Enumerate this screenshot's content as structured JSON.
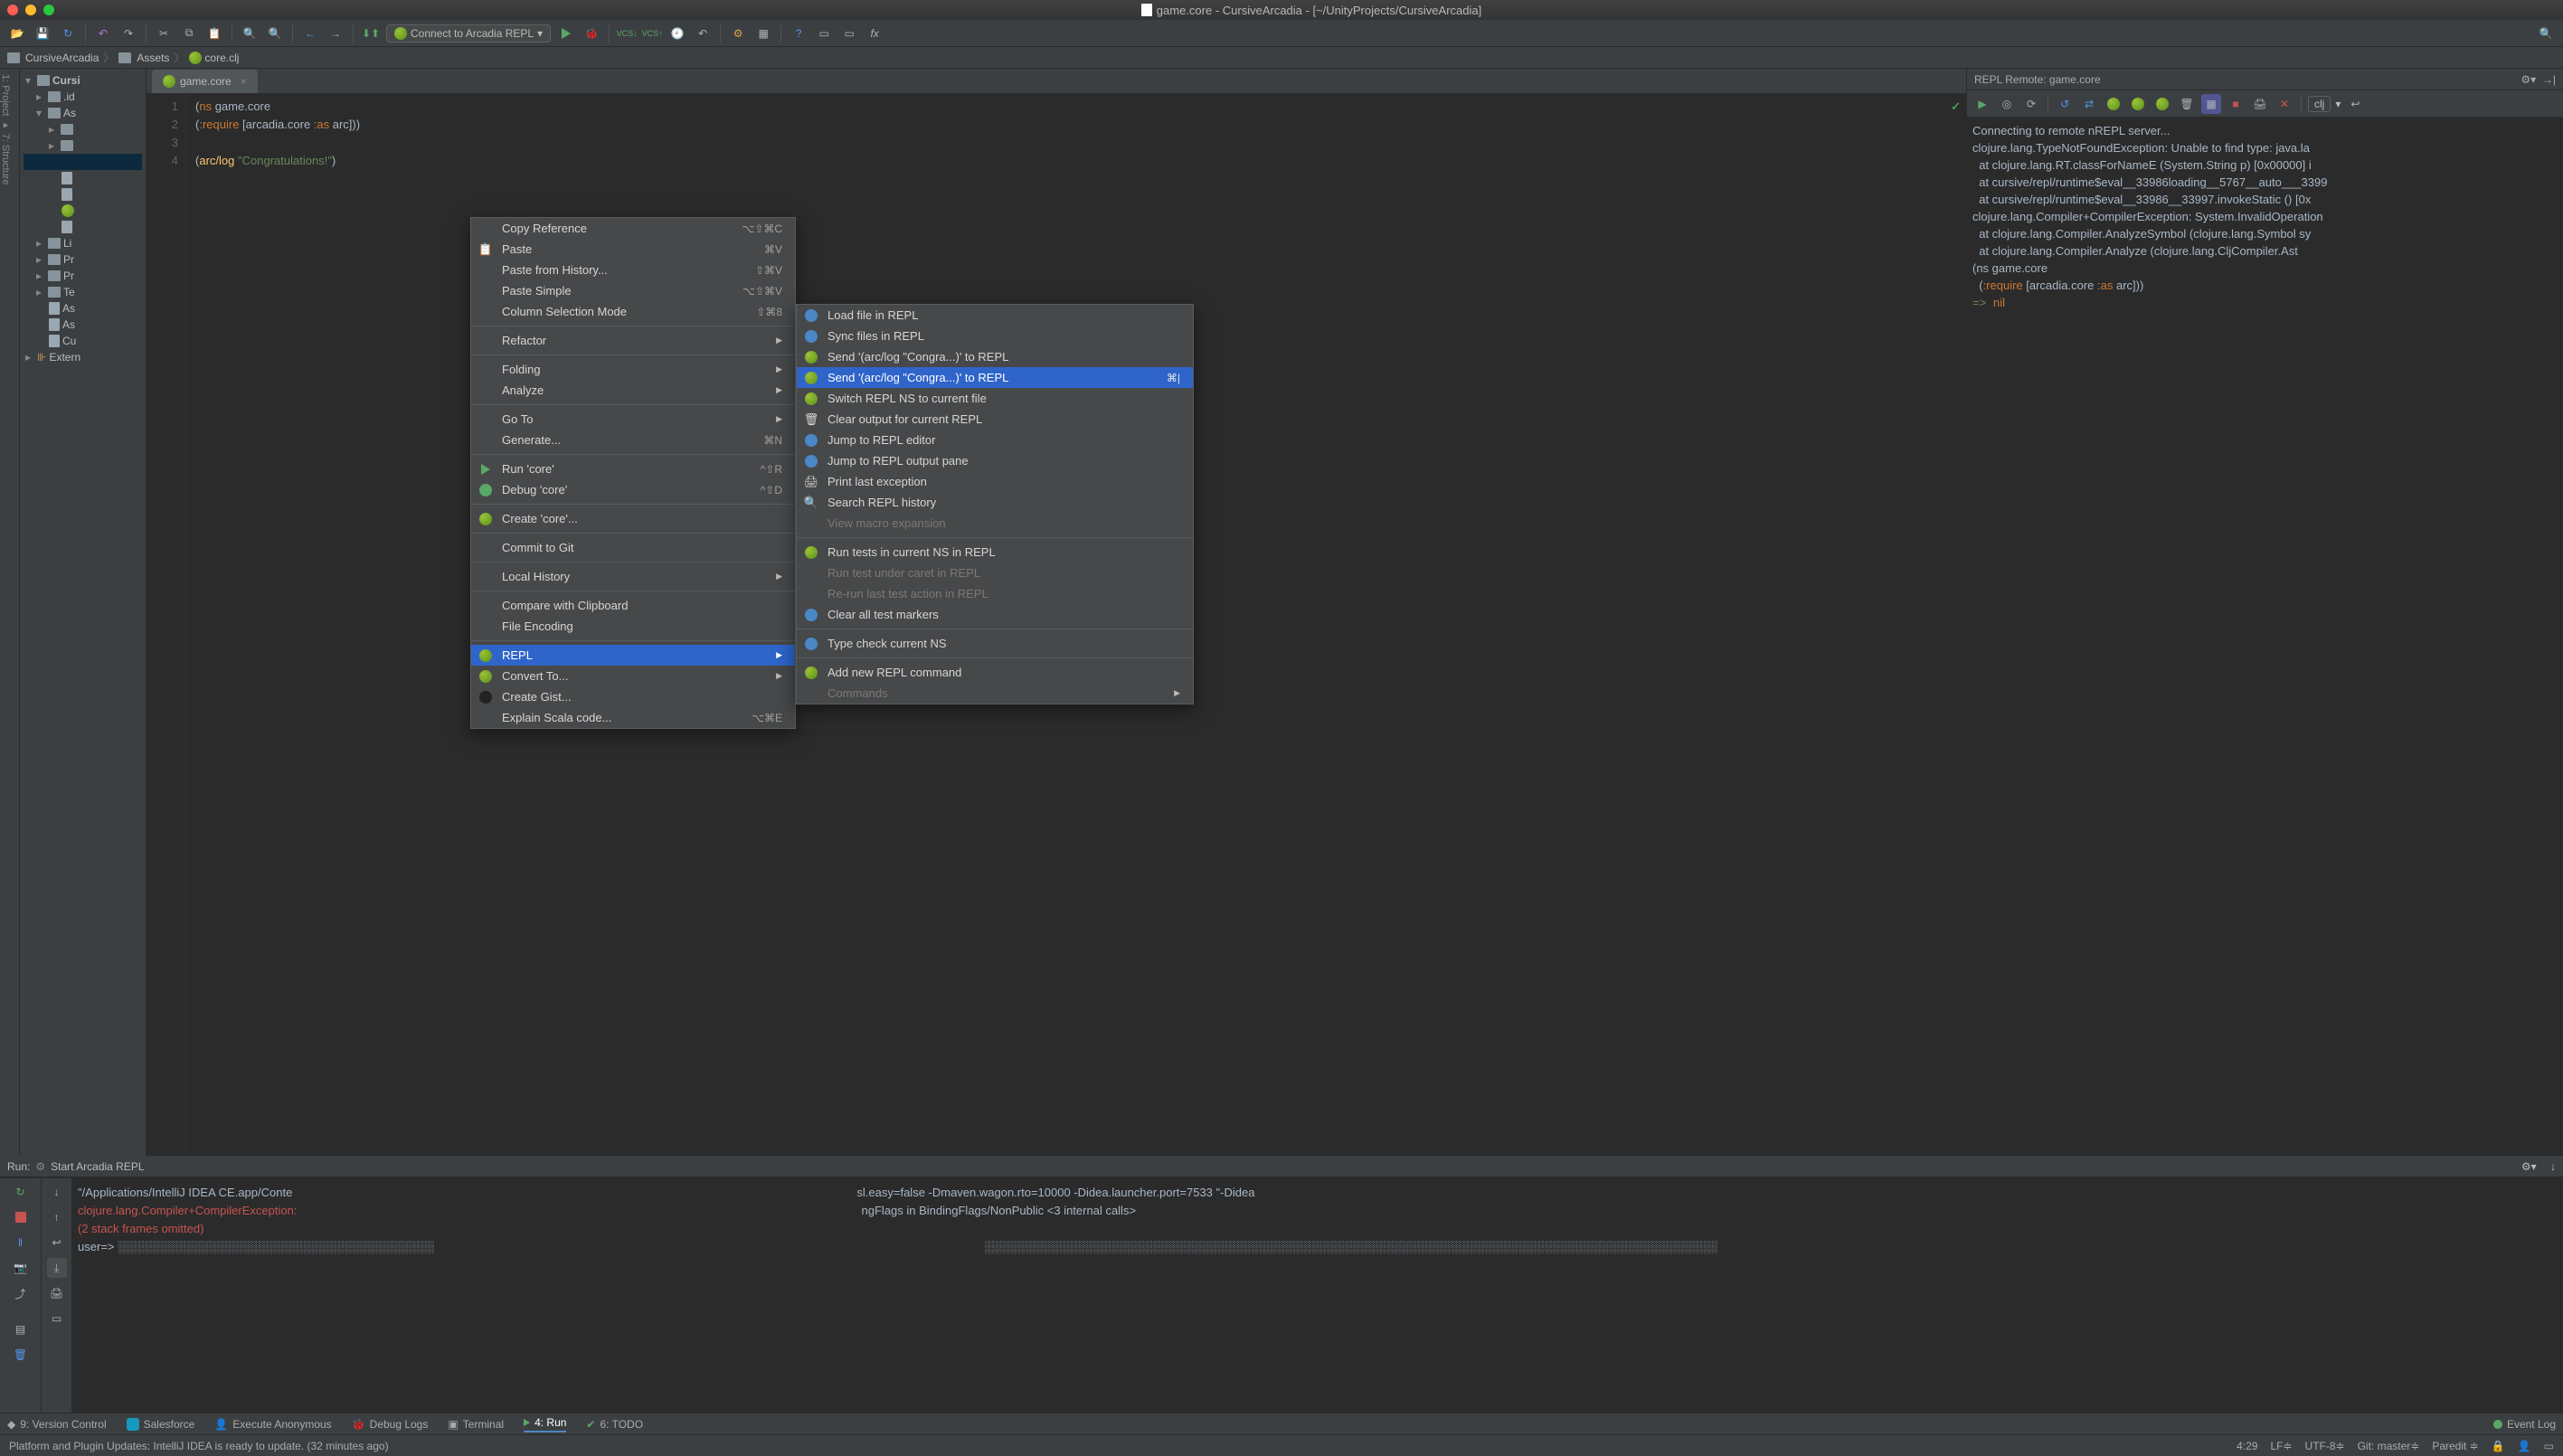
{
  "title": "game.core - CursiveArcadia - [~/UnityProjects/CursiveArcadia]",
  "run_config": "Connect to Arcadia REPL",
  "breadcrumb": {
    "a": "CursiveArcadia",
    "b": "Assets",
    "c": "core.clj"
  },
  "tree": {
    "root": "Cursi",
    "items": [
      ".id",
      "As",
      "",
      "",
      "",
      "",
      "",
      "Li",
      "Pr",
      "Pr",
      "Te",
      "As",
      "As",
      "Cu",
      "Extern"
    ]
  },
  "tab_name": "game.core",
  "code": {
    "l1a": "(",
    "l1b": "ns",
    "l1c": " game.core",
    "l2a": "  (",
    "l2b": ":require",
    "l2c": " [arcadia.core ",
    "l2d": ":as",
    "l2e": " arc]))",
    "l4a": "(",
    "l4b": "arc/log",
    "l4c": " ",
    "l4d": "\"Congratulations!\"",
    "l4e": ")"
  },
  "menu1": [
    {
      "label": "Copy Reference",
      "sc": "⌥⇧⌘C"
    },
    {
      "label": "Paste",
      "sc": "⌘V",
      "ico": "paste"
    },
    {
      "label": "Paste from History...",
      "sc": "⇧⌘V"
    },
    {
      "label": "Paste Simple",
      "sc": "⌥⇧⌘V"
    },
    {
      "label": "Column Selection Mode",
      "sc": "⇧⌘8"
    },
    {
      "sep": true
    },
    {
      "label": "Refactor",
      "arrow": true
    },
    {
      "sep": true
    },
    {
      "label": "Folding",
      "arrow": true
    },
    {
      "label": "Analyze",
      "arrow": true
    },
    {
      "sep": true
    },
    {
      "label": "Go To",
      "arrow": true
    },
    {
      "label": "Generate...",
      "sc": "⌘N"
    },
    {
      "sep": true
    },
    {
      "label": "Run 'core'",
      "sc": "^⇧R",
      "ico": "play"
    },
    {
      "label": "Debug 'core'",
      "sc": "^⇧D",
      "ico": "bug"
    },
    {
      "sep": true
    },
    {
      "label": "Create 'core'...",
      "ico": "repl"
    },
    {
      "sep": true
    },
    {
      "label": "Commit to Git"
    },
    {
      "sep": true
    },
    {
      "label": "Local History",
      "arrow": true
    },
    {
      "sep": true
    },
    {
      "label": "Compare with Clipboard"
    },
    {
      "label": "File Encoding"
    },
    {
      "sep": true
    },
    {
      "label": "REPL",
      "arrow": true,
      "hl": true,
      "ico": "repl"
    },
    {
      "label": "Convert To...",
      "arrow": true,
      "ico": "repl"
    },
    {
      "label": "Create Gist...",
      "ico": "gh"
    },
    {
      "label": "Explain Scala code...",
      "sc": "⌥⌘E"
    }
  ],
  "menu2": [
    {
      "label": "Load file in REPL",
      "ico": "repl-blue"
    },
    {
      "label": "Sync files in REPL",
      "ico": "repl-blue"
    },
    {
      "label": "Send '(arc/log \"Congra...)' to REPL",
      "ico": "repl"
    },
    {
      "label": "Send '(arc/log \"Congra...)' to REPL",
      "ico": "repl",
      "hl": true,
      "sc": "⌘|"
    },
    {
      "label": "Switch REPL NS to current file",
      "ico": "repl"
    },
    {
      "label": "Clear output for current REPL",
      "ico": "trash"
    },
    {
      "label": "Jump to REPL editor",
      "ico": "repl-blue"
    },
    {
      "label": "Jump to REPL output pane",
      "ico": "repl-blue"
    },
    {
      "label": "Print last exception",
      "ico": "print"
    },
    {
      "label": "Search REPL history",
      "ico": "search"
    },
    {
      "label": "View macro expansion",
      "disabled": true
    },
    {
      "sep": true
    },
    {
      "label": "Run tests in current NS in REPL",
      "ico": "repl"
    },
    {
      "label": "Run test under caret in REPL",
      "disabled": true
    },
    {
      "label": "Re-run last test action in REPL",
      "disabled": true
    },
    {
      "label": "Clear all test markers",
      "ico": "repl-blue"
    },
    {
      "sep": true
    },
    {
      "label": "Type check current NS",
      "ico": "type"
    },
    {
      "sep": true
    },
    {
      "label": "Add new REPL command",
      "ico": "repl"
    },
    {
      "label": "Commands",
      "arrow": true,
      "disabled": true
    }
  ],
  "repl": {
    "head": "REPL Remote: game.core",
    "clj": "clj",
    "body": "Connecting to remote nREPL server...\nclojure.lang.TypeNotFoundException: Unable to find type: java.la\n  at clojure.lang.RT.classForNameE (System.String p) [0x00000] i\n  at cursive/repl/runtime$eval__33986loading__5767__auto___3399\n  at cursive/repl/runtime$eval__33986__33997.invokeStatic () [0x\nclojure.lang.Compiler+CompilerException: System.InvalidOperation\n  at clojure.lang.Compiler.AnalyzeSymbol (clojure.lang.Symbol sy\n  at clojure.lang.Compiler.Analyze (clojure.lang.CljCompiler.Ast",
    "ns_line_a": "(ns ",
    "ns_line_b": "game.core",
    "req_line_a": "  (",
    "req_line_b": ":require",
    "req_line_c": " [arcadia.core ",
    "req_line_d": ":as",
    "req_line_e": " arc]))",
    "arrow": "=>",
    "nil": "nil"
  },
  "run": {
    "label": "Run:",
    "name": "Start Arcadia REPL",
    "line1": "\"/Applications/IntelliJ IDEA CE.app/Conte",
    "line1b": "sl.easy=false -Dmaven.wagon.rto=10000 -Didea.launcher.port=7533 \"-Didea",
    "line2": "clojure.lang.Compiler+CompilerException:",
    "line2b": "ngFlags in BindingFlags/NonPublic <3 internal calls>",
    "line3": "(2 stack frames omitted)",
    "line4": "user=> ░░░░░░░░░░░░░░░░░░░░░░░░░░░░░░░░░░░░░░",
    "line4b": "░░░░░░░░░░░░░░░░░░░░░░░░░░░░░░░░░░░░░░░░░░░░░░░░░░░░░░░░░░░░░░░░░░░░░░░░░░░░░░░░░░░░░░░░"
  },
  "bottom_tabs": {
    "vc": "9: Version Control",
    "sf": "Salesforce",
    "ea": "Execute Anonymous",
    "dl": "Debug Logs",
    "term": "Terminal",
    "run": "4: Run",
    "todo": "6: TODO",
    "el": "Event Log"
  },
  "status": {
    "msg": "Platform and Plugin Updates: IntelliJ IDEA is ready to update. (32 minutes ago)",
    "pos": "4:29",
    "lf": "LF≑",
    "enc": "UTF-8≑",
    "git": "Git: master≑",
    "par": "Paredit ≑"
  }
}
